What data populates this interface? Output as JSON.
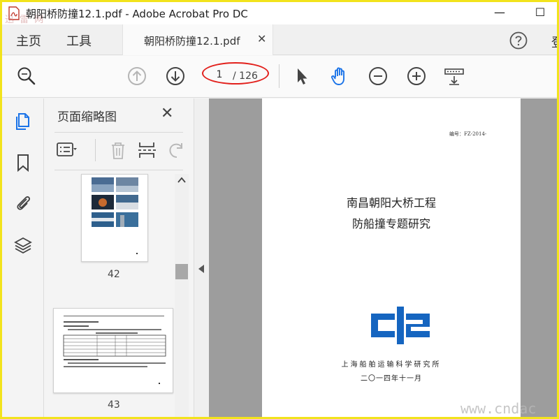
{
  "window": {
    "title": "朝阳桥防撞12.1.pdf - Adobe Acrobat Pro DC",
    "watermark_logo": "迅 雷 网",
    "minimize": "—",
    "maximize": "☐"
  },
  "menu": {
    "home": "主页",
    "tools": "工具",
    "doc_tab": "朝阳桥防撞12.1.pdf",
    "doc_tab_close": "✕",
    "cut_text": "登"
  },
  "toolbar": {
    "current_page": "1",
    "total_pages": "/ 126",
    "highlight_color": "#e2201c",
    "accent_color": "#1a73e8"
  },
  "rail": {
    "icons": [
      "pages-icon",
      "bookmark-icon",
      "attachment-icon",
      "layers-icon"
    ]
  },
  "thumbnail_panel": {
    "title": "页面缩略图",
    "close": "✕",
    "thumbnails": [
      {
        "page_label": "42"
      },
      {
        "page_label": "43"
      }
    ]
  },
  "document": {
    "code": "编号：FZ-2014-",
    "title_line1": "南昌朝阳大桥工程",
    "title_line2": "防船撞专题研究",
    "organization": "上海船舶运输科学研究所",
    "date": "二〇一四年十一月",
    "logo_color": "#1565c0"
  },
  "watermark": "www.cndac"
}
